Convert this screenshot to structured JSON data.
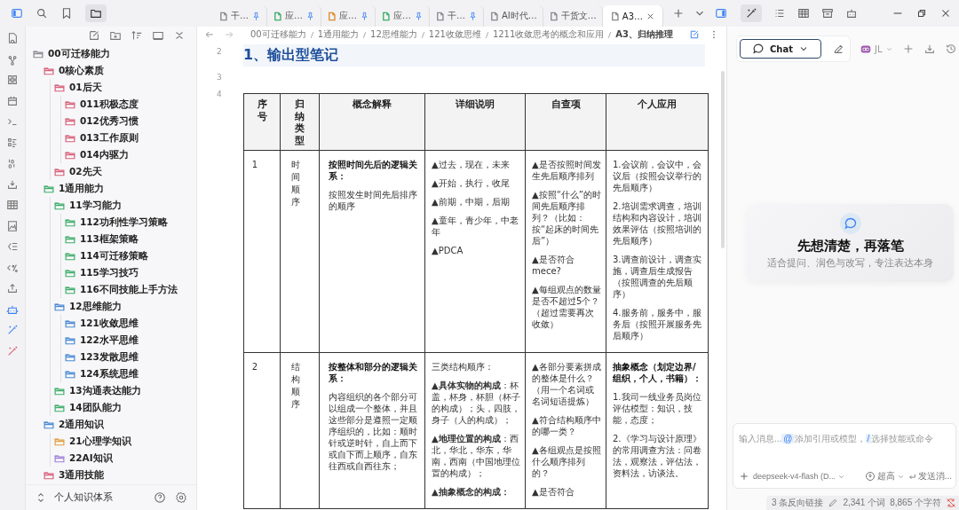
{
  "top_bar": {
    "tabs": [
      {
        "label": "干…",
        "color": "#8a8a90",
        "pinned": true,
        "selected": false
      },
      {
        "label": "应…",
        "color": "#3fae6a",
        "pinned": true,
        "selected": false
      },
      {
        "label": "应…",
        "color": "#e08a2c",
        "pinned": true,
        "selected": false
      },
      {
        "label": "应…",
        "color": "#3fae6a",
        "pinned": true,
        "selected": false
      },
      {
        "label": "干…",
        "color": "#8a8a90",
        "pinned": true,
        "selected": false
      },
      {
        "label": "AI时代…",
        "color": "#8a8a90",
        "pinned": false,
        "selected": false
      },
      {
        "label": "干货文…",
        "color": "#8a8a90",
        "pinned": false,
        "selected": false
      },
      {
        "label": "A3…",
        "color": "#8a8a90",
        "pinned": false,
        "selected": true
      }
    ]
  },
  "sidebar": {
    "tree": [
      {
        "label": "00可迁移能力",
        "color": "#8a8a90",
        "children": [
          {
            "label": "0核心素质",
            "color": "#d9607a",
            "children": [
              {
                "label": "01后天",
                "color": "#d9607a",
                "children": [
                  {
                    "label": "011积极态度",
                    "color": "#d9607a"
                  },
                  {
                    "label": "012优秀习惯",
                    "color": "#d9607a"
                  },
                  {
                    "label": "013工作原则",
                    "color": "#d9607a"
                  },
                  {
                    "label": "014内驱力",
                    "color": "#d9607a"
                  }
                ]
              },
              {
                "label": "02先天",
                "color": "#d9607a"
              }
            ]
          },
          {
            "label": "1通用能力",
            "color": "#3fae6a",
            "children": [
              {
                "label": "11学习能力",
                "color": "#3fae6a",
                "children": [
                  {
                    "label": "112功利性学习策略",
                    "color": "#3fae6a"
                  },
                  {
                    "label": "113框架策略",
                    "color": "#3fae6a"
                  },
                  {
                    "label": "114可迁移策略",
                    "color": "#3fae6a"
                  },
                  {
                    "label": "115学习技巧",
                    "color": "#3fae6a"
                  },
                  {
                    "label": "116不同技能上手方法",
                    "color": "#3fae6a"
                  }
                ]
              },
              {
                "label": "12思维能力",
                "color": "#4a8ad4",
                "children": [
                  {
                    "label": "121收敛思维",
                    "color": "#4a8ad4"
                  },
                  {
                    "label": "122水平思维",
                    "color": "#4a8ad4"
                  },
                  {
                    "label": "123发散思维",
                    "color": "#4a8ad4"
                  },
                  {
                    "label": "124系统思维",
                    "color": "#4a8ad4"
                  }
                ]
              },
              {
                "label": "13沟通表达能力",
                "color": "#3fae6a"
              },
              {
                "label": "14团队能力",
                "color": "#3fae6a"
              }
            ]
          },
          {
            "label": "2通用知识",
            "color": "#4a8ad4",
            "children": [
              {
                "label": "21心理学知识",
                "color": "#e0a040"
              },
              {
                "label": "22AI知识",
                "color": "#a080d8"
              }
            ]
          },
          {
            "label": "3通用技能",
            "color": "#d9607a"
          }
        ]
      }
    ],
    "vault": "个人知识体系"
  },
  "editor": {
    "breadcrumbs": [
      "00可迁移能力",
      "1通用能力",
      "12思维能力",
      "121收敛思维",
      "1211收敛思考的概念和应用",
      "A3、归纳推理"
    ],
    "line_numbers": [
      "2",
      "3",
      "4"
    ],
    "heading": "1、输出型笔记",
    "table": {
      "columns": [
        {
          "label": "序号",
          "kind": "stacked"
        },
        {
          "label": "归纳类型",
          "kind": "stacked"
        },
        {
          "label": "概念解释",
          "kind": "plain"
        },
        {
          "label": "详细说明",
          "kind": "plain"
        },
        {
          "label": "自查项",
          "kind": "plain"
        },
        {
          "label": "个人应用",
          "kind": "plain"
        }
      ],
      "rows": [
        {
          "cells": [
            {
              "paragraphs": [
                "1"
              ]
            },
            {
              "paragraphs": [
                "时间顺序"
              ]
            },
            {
              "title": "按照时间先后的逻辑关系：",
              "paragraphs": [
                "按照发生时间先后排序的顺序"
              ]
            },
            {
              "paragraphs": [
                "▲过去，现在，未来",
                "▲开始，执行，收尾",
                "▲前期，中期，后期",
                "▲童年，青少年，中老年",
                "▲PDCA"
              ]
            },
            {
              "paragraphs": [
                "▲是否按照时间发生先后顺序排列",
                "▲按照“什么”的时间先后顺序排列？（比如：按“起床的时间先后”）",
                "▲是否符合mece?",
                "▲每组观点的数量是否不超过5个？（超过需要再次收敛）"
              ]
            },
            {
              "paragraphs": [
                "1.会议前，会议中，会议后（按照会议举行的先后顺序）",
                "2.培训需求调查，培训结构和内容设计，培训效果评估（按照培训的先后顺序）",
                "3.调查前设计，调查实施，调查后生成报告（按照调查的先后顺序）",
                "4.服务前，服务中，服务后（按照开展服务先后顺序）"
              ]
            }
          ]
        },
        {
          "cells": [
            {
              "paragraphs": [
                "2"
              ]
            },
            {
              "paragraphs": [
                "结构顺序"
              ]
            },
            {
              "title": "按整体和部分的逻辑关系：",
              "paragraphs": [
                "内容组织的各个部分可以组成一个整体，并且这些部分是遵照一定顺序组织的，比如：顺时针或逆时针，自上而下或自下而上顺序，自东往西或自西往东；"
              ]
            },
            {
              "paragraphs": [
                "三类结构顺序：",
                "**▲具体实物的构成**：杯盖，杯身，杯胆（杯子的构成）；头，四肢，身子（人的构成）；",
                "**▲地理位置的构成**：西北，华北，华东，华南，西南（中国地理位置的构成）；",
                "**▲抽象概念的构成：**"
              ]
            },
            {
              "paragraphs": [
                "▲各部分要素拼成的整体是什么？（用一个名词或名词短语提炼）",
                "▲符合结构顺序中的哪一类？",
                "▲各组观点是按照什么顺序排列的？",
                "▲是否符合"
              ]
            },
            {
              "title": "抽象概念（划定边界/组织，个人，书籍）：",
              "paragraphs": [
                "1.我司一线业务员岗位评估模型：知识，技能，态度；",
                "2.《学习与设计原理》的常用调查方法：问卷法，观察法，评估法，资料法，访谈法。"
              ]
            }
          ]
        }
      ]
    }
  },
  "chat_panel": {
    "mode": "Chat",
    "user": "JL",
    "empty_title": "先想清楚，再落笔",
    "empty_subtitle": "适合提问、润色与改写，专注表达本身",
    "input": {
      "placeholder": "输入消息...",
      "hints": [
        {
          "key": "@",
          "text": "添加引用或模型，"
        },
        {
          "key": "/",
          "text": "选择技能或命令"
        }
      ]
    },
    "model": "deepseek-v4-flash (D...",
    "effort": "超高",
    "send": "发送消..."
  },
  "status_bar": {
    "backlinks": "3 条反向链接",
    "words": "2,341 个词",
    "chars": "8,865 个字符"
  }
}
